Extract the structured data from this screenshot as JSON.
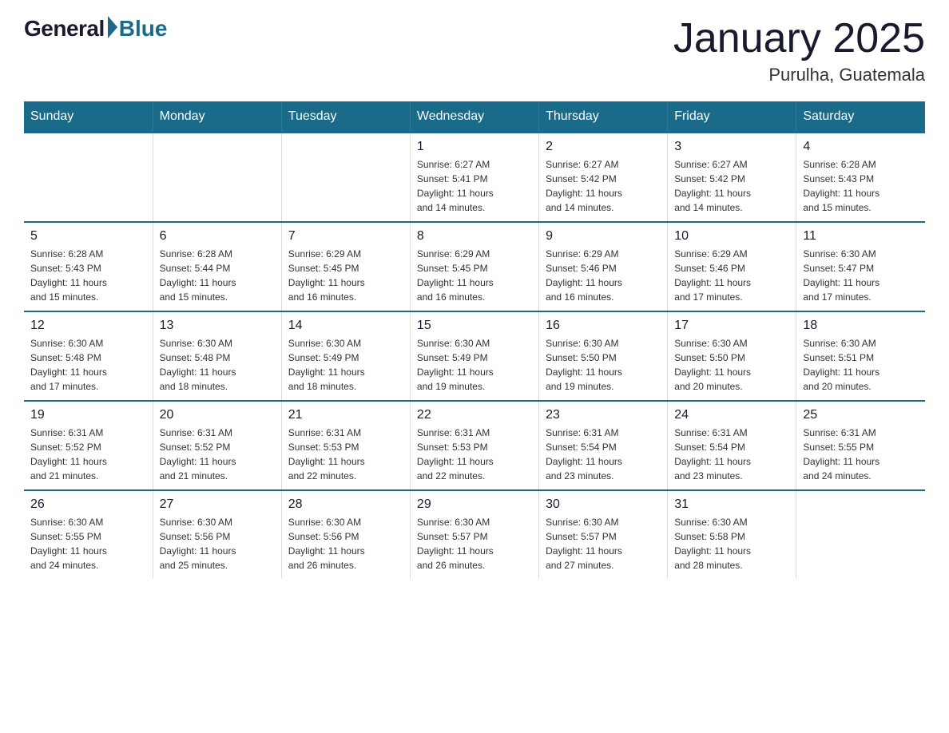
{
  "logo": {
    "general": "General",
    "blue": "Blue"
  },
  "title": "January 2025",
  "subtitle": "Purulha, Guatemala",
  "days_of_week": [
    "Sunday",
    "Monday",
    "Tuesday",
    "Wednesday",
    "Thursday",
    "Friday",
    "Saturday"
  ],
  "weeks": [
    [
      {
        "day": "",
        "info": ""
      },
      {
        "day": "",
        "info": ""
      },
      {
        "day": "",
        "info": ""
      },
      {
        "day": "1",
        "info": "Sunrise: 6:27 AM\nSunset: 5:41 PM\nDaylight: 11 hours\nand 14 minutes."
      },
      {
        "day": "2",
        "info": "Sunrise: 6:27 AM\nSunset: 5:42 PM\nDaylight: 11 hours\nand 14 minutes."
      },
      {
        "day": "3",
        "info": "Sunrise: 6:27 AM\nSunset: 5:42 PM\nDaylight: 11 hours\nand 14 minutes."
      },
      {
        "day": "4",
        "info": "Sunrise: 6:28 AM\nSunset: 5:43 PM\nDaylight: 11 hours\nand 15 minutes."
      }
    ],
    [
      {
        "day": "5",
        "info": "Sunrise: 6:28 AM\nSunset: 5:43 PM\nDaylight: 11 hours\nand 15 minutes."
      },
      {
        "day": "6",
        "info": "Sunrise: 6:28 AM\nSunset: 5:44 PM\nDaylight: 11 hours\nand 15 minutes."
      },
      {
        "day": "7",
        "info": "Sunrise: 6:29 AM\nSunset: 5:45 PM\nDaylight: 11 hours\nand 16 minutes."
      },
      {
        "day": "8",
        "info": "Sunrise: 6:29 AM\nSunset: 5:45 PM\nDaylight: 11 hours\nand 16 minutes."
      },
      {
        "day": "9",
        "info": "Sunrise: 6:29 AM\nSunset: 5:46 PM\nDaylight: 11 hours\nand 16 minutes."
      },
      {
        "day": "10",
        "info": "Sunrise: 6:29 AM\nSunset: 5:46 PM\nDaylight: 11 hours\nand 17 minutes."
      },
      {
        "day": "11",
        "info": "Sunrise: 6:30 AM\nSunset: 5:47 PM\nDaylight: 11 hours\nand 17 minutes."
      }
    ],
    [
      {
        "day": "12",
        "info": "Sunrise: 6:30 AM\nSunset: 5:48 PM\nDaylight: 11 hours\nand 17 minutes."
      },
      {
        "day": "13",
        "info": "Sunrise: 6:30 AM\nSunset: 5:48 PM\nDaylight: 11 hours\nand 18 minutes."
      },
      {
        "day": "14",
        "info": "Sunrise: 6:30 AM\nSunset: 5:49 PM\nDaylight: 11 hours\nand 18 minutes."
      },
      {
        "day": "15",
        "info": "Sunrise: 6:30 AM\nSunset: 5:49 PM\nDaylight: 11 hours\nand 19 minutes."
      },
      {
        "day": "16",
        "info": "Sunrise: 6:30 AM\nSunset: 5:50 PM\nDaylight: 11 hours\nand 19 minutes."
      },
      {
        "day": "17",
        "info": "Sunrise: 6:30 AM\nSunset: 5:50 PM\nDaylight: 11 hours\nand 20 minutes."
      },
      {
        "day": "18",
        "info": "Sunrise: 6:30 AM\nSunset: 5:51 PM\nDaylight: 11 hours\nand 20 minutes."
      }
    ],
    [
      {
        "day": "19",
        "info": "Sunrise: 6:31 AM\nSunset: 5:52 PM\nDaylight: 11 hours\nand 21 minutes."
      },
      {
        "day": "20",
        "info": "Sunrise: 6:31 AM\nSunset: 5:52 PM\nDaylight: 11 hours\nand 21 minutes."
      },
      {
        "day": "21",
        "info": "Sunrise: 6:31 AM\nSunset: 5:53 PM\nDaylight: 11 hours\nand 22 minutes."
      },
      {
        "day": "22",
        "info": "Sunrise: 6:31 AM\nSunset: 5:53 PM\nDaylight: 11 hours\nand 22 minutes."
      },
      {
        "day": "23",
        "info": "Sunrise: 6:31 AM\nSunset: 5:54 PM\nDaylight: 11 hours\nand 23 minutes."
      },
      {
        "day": "24",
        "info": "Sunrise: 6:31 AM\nSunset: 5:54 PM\nDaylight: 11 hours\nand 23 minutes."
      },
      {
        "day": "25",
        "info": "Sunrise: 6:31 AM\nSunset: 5:55 PM\nDaylight: 11 hours\nand 24 minutes."
      }
    ],
    [
      {
        "day": "26",
        "info": "Sunrise: 6:30 AM\nSunset: 5:55 PM\nDaylight: 11 hours\nand 24 minutes."
      },
      {
        "day": "27",
        "info": "Sunrise: 6:30 AM\nSunset: 5:56 PM\nDaylight: 11 hours\nand 25 minutes."
      },
      {
        "day": "28",
        "info": "Sunrise: 6:30 AM\nSunset: 5:56 PM\nDaylight: 11 hours\nand 26 minutes."
      },
      {
        "day": "29",
        "info": "Sunrise: 6:30 AM\nSunset: 5:57 PM\nDaylight: 11 hours\nand 26 minutes."
      },
      {
        "day": "30",
        "info": "Sunrise: 6:30 AM\nSunset: 5:57 PM\nDaylight: 11 hours\nand 27 minutes."
      },
      {
        "day": "31",
        "info": "Sunrise: 6:30 AM\nSunset: 5:58 PM\nDaylight: 11 hours\nand 28 minutes."
      },
      {
        "day": "",
        "info": ""
      }
    ]
  ]
}
